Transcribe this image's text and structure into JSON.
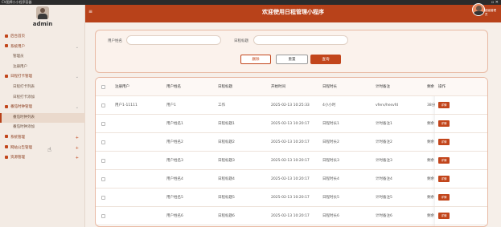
{
  "window": {
    "title": "CV图牌小小程序容器",
    "controls": "▫ ✕"
  },
  "sidebar": {
    "username": "admin",
    "items": [
      {
        "label": "后台首页",
        "type": "parent",
        "arrow": ""
      },
      {
        "label": "系统用户",
        "type": "parent",
        "arrow": "⌄"
      },
      {
        "label": "管理员",
        "type": "sub"
      },
      {
        "label": "注册用户",
        "type": "sub"
      },
      {
        "label": "日程打卡管理",
        "type": "parent",
        "arrow": "⌄"
      },
      {
        "label": "日程打卡列表",
        "type": "sub"
      },
      {
        "label": "日程打卡添加",
        "type": "sub"
      },
      {
        "label": "番茄时钟管理",
        "type": "parent",
        "arrow": "⌄"
      },
      {
        "label": "番茄时钟列表",
        "type": "sub",
        "active": true
      },
      {
        "label": "番茄时钟添加",
        "type": "sub"
      },
      {
        "label": "系统管理",
        "type": "parent",
        "arrow": "+"
      },
      {
        "label": "网站公告管理",
        "type": "parent",
        "arrow": "+"
      },
      {
        "label": "资源管理",
        "type": "parent",
        "arrow": "+"
      }
    ]
  },
  "header": {
    "title": "欢迎使用日程管理小程序",
    "menu_icon": "≡",
    "user": "超级管理员"
  },
  "search": {
    "user_name_label": "用户姓名",
    "schedule_title_label": "日程标题",
    "user_name_value": "",
    "schedule_title_value": "",
    "delete_label": "删除",
    "reset_label": "重置",
    "query_label": "查询"
  },
  "table": {
    "columns": [
      "注册用户",
      "用户姓名",
      "日程标题",
      "开始时间",
      "日程时长",
      "计时备注",
      "剩余",
      "操作"
    ],
    "rows": [
      {
        "user": "用户1-11111",
        "name": "用户1",
        "title": "工作",
        "start": "2025-02-13 10:25:33",
        "duration": "4小小时",
        "note": "vferv/hesvfd",
        "remain": "38分"
      },
      {
        "user": "",
        "name": "用户姓名1",
        "title": "日程标题1",
        "start": "2025-02-13 10:20:17",
        "duration": "日程时长1",
        "note": "计时备注1",
        "remain": "剩余"
      },
      {
        "user": "",
        "name": "用户姓名2",
        "title": "日程标题2",
        "start": "2025-02-13 10:20:17",
        "duration": "日程时长2",
        "note": "计时备注2",
        "remain": "剩余"
      },
      {
        "user": "",
        "name": "用户姓名3",
        "title": "日程标题3",
        "start": "2025-02-13 10:20:17",
        "duration": "日程时长3",
        "note": "计时备注3",
        "remain": "剩余"
      },
      {
        "user": "",
        "name": "用户姓名4",
        "title": "日程标题4",
        "start": "2025-02-13 10:20:17",
        "duration": "日程时长4",
        "note": "计时备注4",
        "remain": "剩余"
      },
      {
        "user": "",
        "name": "用户姓名5",
        "title": "日程标题5",
        "start": "2025-02-13 10:20:17",
        "duration": "日程时长5",
        "note": "计时备注5",
        "remain": "剩余"
      },
      {
        "user": "",
        "name": "用户姓名6",
        "title": "日程标题6",
        "start": "2025-02-13 10:20:17",
        "duration": "日程时长6",
        "note": "计时备注6",
        "remain": "剩余"
      }
    ],
    "edit_label": "详情"
  },
  "colors": {
    "brand": "#b8421a",
    "accent": "#c2451b",
    "sidebar_bg": "#f3ebe4",
    "page_bg": "#f6efe9"
  }
}
